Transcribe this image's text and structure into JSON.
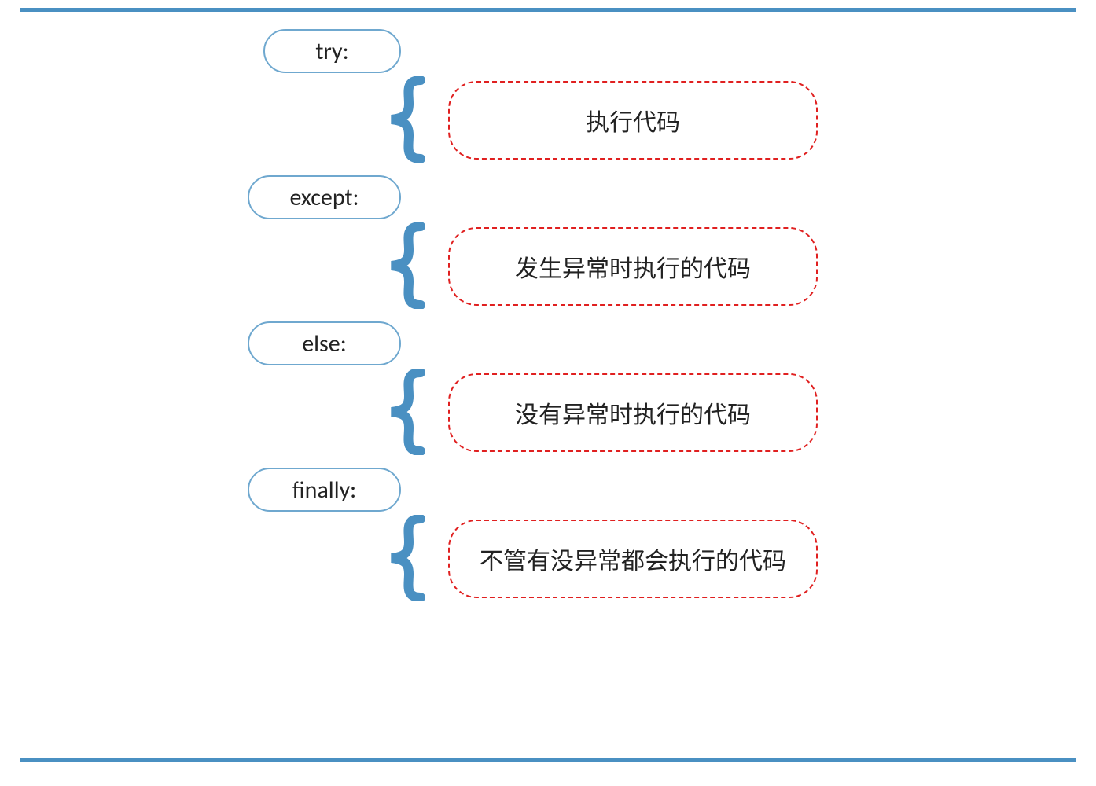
{
  "colors": {
    "hr": "#4a90c2",
    "pill_border": "#6fa8cf",
    "brace": "#4a90c2",
    "desc_border": "#e02020",
    "text": "#222222"
  },
  "sections": [
    {
      "keyword": "try:",
      "description": "执行代码"
    },
    {
      "keyword": "except:",
      "description": "发生异常时执行的代码"
    },
    {
      "keyword": "else:",
      "description": "没有异常时执行的代码"
    },
    {
      "keyword": "finally:",
      "description": "不管有没异常都会执行的代码"
    }
  ]
}
